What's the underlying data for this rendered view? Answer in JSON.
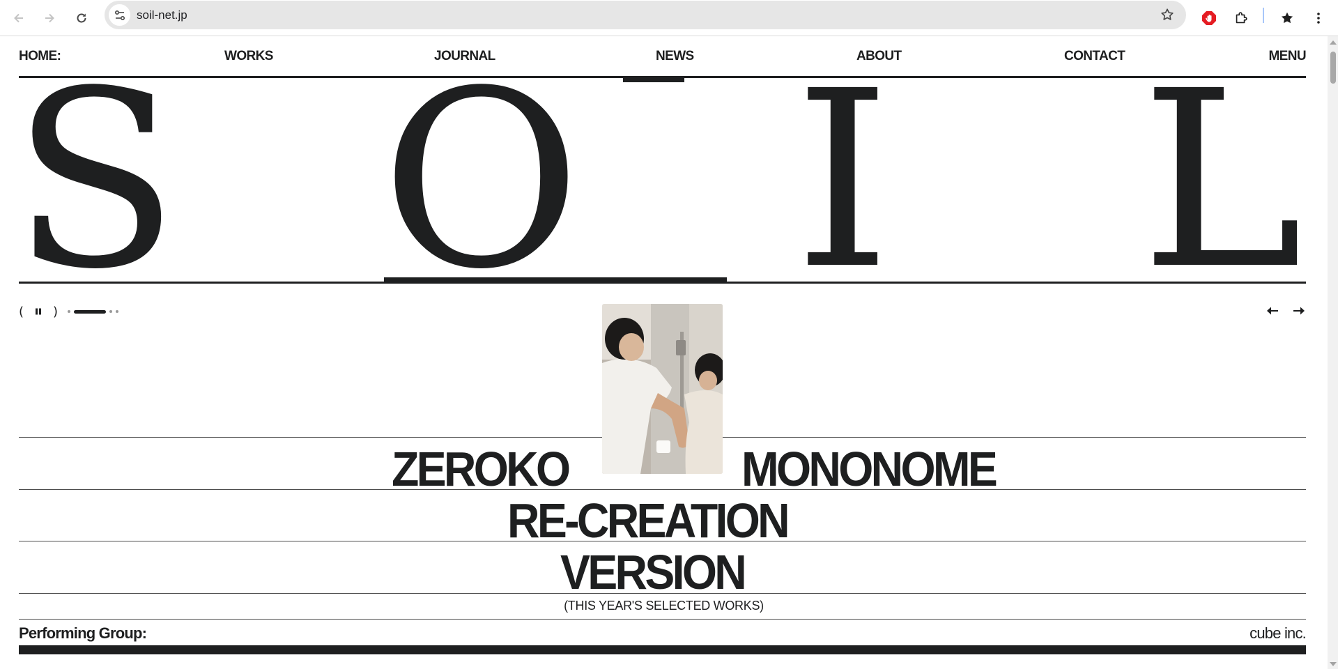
{
  "browser": {
    "url": "soil-net.jp",
    "back_icon": "arrow-left-icon",
    "forward_icon": "arrow-right-icon",
    "reload_icon": "reload-icon",
    "site_info_icon": "tune-icon",
    "bookmark_icon": "star-outline-icon",
    "extensions": [
      "adblock-icon",
      "puzzle-icon",
      "bookmarks-star-icon",
      "kebab-menu-icon"
    ]
  },
  "nav": {
    "home": "HOME:",
    "works": "WORKS",
    "journal": "JOURNAL",
    "news": "NEWS",
    "about": "ABOUT",
    "contact": "CONTACT",
    "menu": "MENU"
  },
  "logo": {
    "s": "S",
    "o": "O",
    "i": "I",
    "l": "L"
  },
  "slider": {
    "open_paren": "(",
    "close_paren": ")",
    "pause_icon": "pause-icon",
    "current_slide": 2,
    "total_slides": 4,
    "prev_icon": "arrow-left-icon",
    "next_icon": "arrow-right-icon"
  },
  "feature": {
    "title_line1_left": "ZEROKO",
    "title_line1_right": "MONONOME",
    "title_line2": "RE-CREATION",
    "title_line3": "VERSION",
    "caption": "(THIS YEAR'S SELECTED WORKS)",
    "meta_label": "Performing Group:",
    "meta_value": "cube inc."
  },
  "colors": {
    "ink": "#1e1f20",
    "chrome_bg": "#e6e6e6",
    "adblock_red": "#e51c23"
  }
}
